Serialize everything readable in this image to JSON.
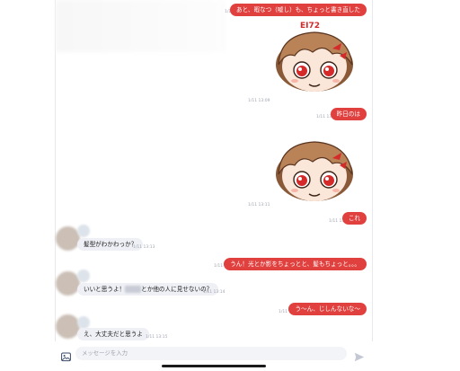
{
  "messages": [
    {
      "id": "m1",
      "dir": "out",
      "text": "あと、暇なつ（嘘し）も、ちょっと書き直した",
      "time": "1/11 13:08"
    },
    {
      "id": "m2",
      "dir": "out-sticker",
      "time": "1/11 13:09"
    },
    {
      "id": "m3",
      "dir": "out",
      "text": "昨日のは",
      "time": "1/11 13:11"
    },
    {
      "id": "m4",
      "dir": "out-sticker",
      "time": "1/11 13:11"
    },
    {
      "id": "m5",
      "dir": "out",
      "text": "これ",
      "time": "1/11 13:11"
    },
    {
      "id": "m6",
      "dir": "in",
      "text": "髪型がわかわっか？",
      "time": "1/11 13:13"
    },
    {
      "id": "m7",
      "dir": "out",
      "text": "うん！光とか影をちょっとと、髪もちょっと。。。",
      "time": "1/11 13:13"
    },
    {
      "id": "m8",
      "dir": "in",
      "text_before": "いいと思うよ！",
      "text_after": "とか他の人に見せないの？",
      "time": "1/11 13:14"
    },
    {
      "id": "m9",
      "dir": "out",
      "text": "う〜ん、じしんないな〜",
      "time": "1/11 13:15"
    },
    {
      "id": "m10",
      "dir": "in",
      "text": "え、大丈夫だと思うよ",
      "time": "1/11 13:15"
    }
  ],
  "sticker": {
    "badge": "EI72",
    "hair_color": "#b98257",
    "eye_color": "#d42a2a",
    "accent": "#e0403e"
  },
  "input": {
    "placeholder": "メッセージを入力"
  },
  "colors": {
    "outgoing": "#e0403e",
    "incoming": "#eef0f5",
    "timestamp": "#a0a4b0"
  },
  "icons": {
    "attach": "image-icon",
    "send": "send-icon"
  }
}
